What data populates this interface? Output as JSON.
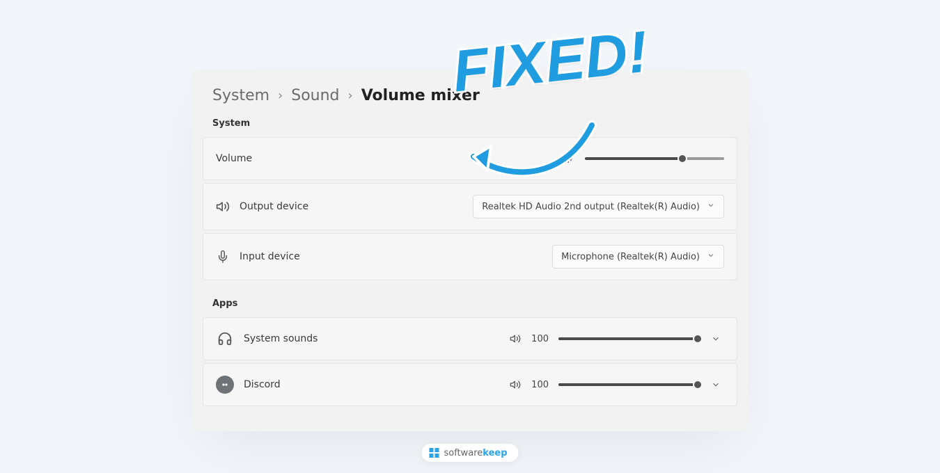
{
  "breadcrumb": {
    "root": "System",
    "level2": "Sound",
    "current": "Volume mixer"
  },
  "sections": {
    "system_label": "System",
    "apps_label": "Apps"
  },
  "system": {
    "volume": {
      "label": "Volume",
      "percent": 70
    },
    "output": {
      "label": "Output device",
      "selected": "Realtek HD Audio 2nd output (Realtek(R) Audio)"
    },
    "input": {
      "label": "Input device",
      "selected": "Microphone (Realtek(R) Audio)"
    }
  },
  "apps": [
    {
      "name": "System sounds",
      "icon": "headphones",
      "value": "100",
      "percent": 100
    },
    {
      "name": "Discord",
      "icon": "discord",
      "value": "100",
      "percent": 100
    }
  ],
  "annotation": {
    "text": "FIXED!"
  },
  "brand": {
    "prefix": "software",
    "bold": "keep"
  }
}
